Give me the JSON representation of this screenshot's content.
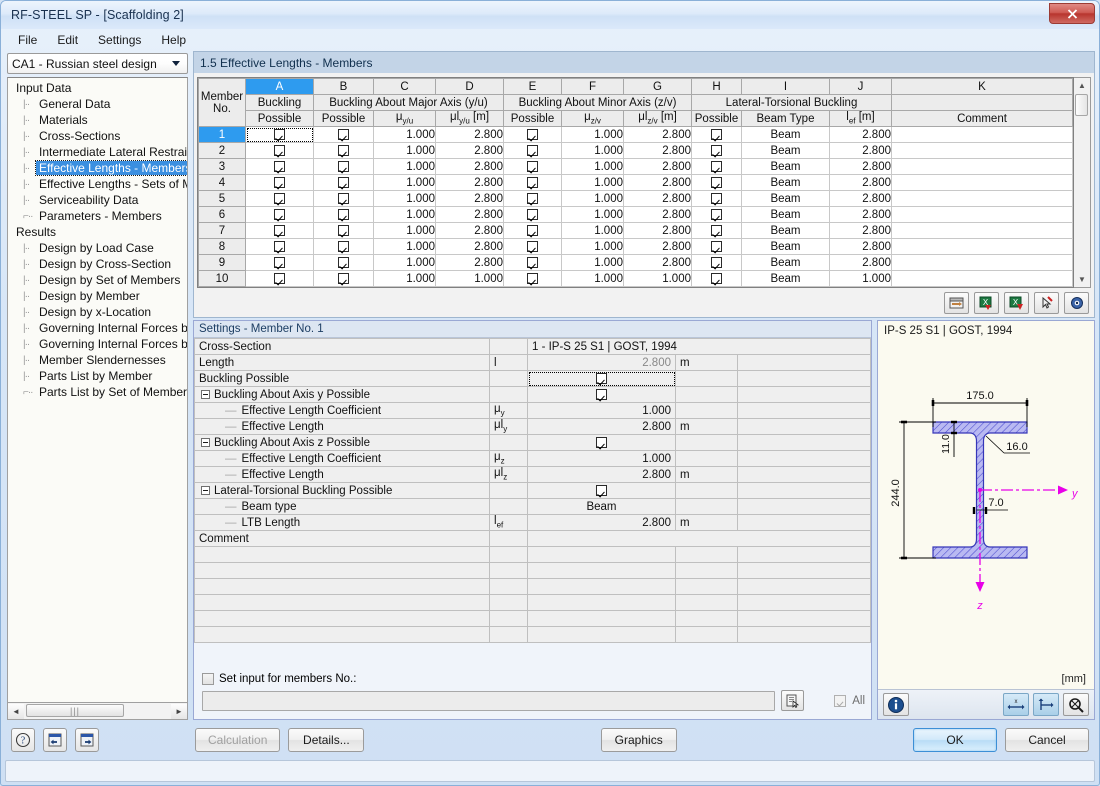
{
  "window": {
    "title": "RF-STEEL SP - [Scaffolding 2]",
    "close_label": "✕"
  },
  "menubar": {
    "items": [
      "File",
      "Edit",
      "Settings",
      "Help"
    ]
  },
  "sidebar": {
    "combo_value": "CA1 - Russian steel design",
    "groups": [
      {
        "label": "Input Data",
        "items": [
          "General Data",
          "Materials",
          "Cross-Sections",
          "Intermediate Lateral Restraints",
          "Effective Lengths - Members",
          "Effective Lengths - Sets of Mem",
          "Serviceability Data",
          "Parameters - Members"
        ],
        "selected": "Effective Lengths - Members"
      },
      {
        "label": "Results",
        "items": [
          "Design by Load Case",
          "Design by Cross-Section",
          "Design by Set of Members",
          "Design by Member",
          "Design by x-Location",
          "Governing Internal Forces by M",
          "Governing Internal Forces by Se",
          "Member Slendernesses",
          "Parts List by Member",
          "Parts List by Set of Members"
        ],
        "selected": ""
      }
    ]
  },
  "main": {
    "section_title": "1.5 Effective Lengths - Members",
    "table": {
      "column_letters": [
        "A",
        "B",
        "C",
        "D",
        "E",
        "F",
        "G",
        "H",
        "I",
        "J",
        "K"
      ],
      "selected_column": "A",
      "group_headers": [
        {
          "label": "",
          "span": 1
        },
        {
          "label": "",
          "span": 1
        },
        {
          "label": "Buckling About Major Axis (y/u)",
          "span": 3
        },
        {
          "label": "Buckling About Minor Axis (z/v)",
          "span": 3
        },
        {
          "label": "Lateral-Torsional Buckling",
          "span": 3
        },
        {
          "label": "",
          "span": 1
        }
      ],
      "row_header_line1": "Member",
      "row_header_line2": "No.",
      "sub_headers": [
        "Buckling",
        "Possible",
        "Possible",
        "μ|y/u|",
        "μl|y/u| [m]",
        "Possible",
        "μ|z/v|",
        "μl|z/v| [m]",
        "Possible",
        "Beam Type",
        "l|ef| [m]",
        "Comment"
      ],
      "sub_header_a_line1": "Buckling",
      "sub_header_a_line2": "Possible",
      "rows": [
        {
          "no": "1",
          "a": true,
          "b": true,
          "mu_y": "1.000",
          "mul_y": "2.800",
          "e": true,
          "mu_z": "1.000",
          "mul_z": "2.800",
          "h": true,
          "beam_type": "Beam",
          "lef": "2.800",
          "comment": ""
        },
        {
          "no": "2",
          "a": true,
          "b": true,
          "mu_y": "1.000",
          "mul_y": "2.800",
          "e": true,
          "mu_z": "1.000",
          "mul_z": "2.800",
          "h": true,
          "beam_type": "Beam",
          "lef": "2.800",
          "comment": ""
        },
        {
          "no": "3",
          "a": true,
          "b": true,
          "mu_y": "1.000",
          "mul_y": "2.800",
          "e": true,
          "mu_z": "1.000",
          "mul_z": "2.800",
          "h": true,
          "beam_type": "Beam",
          "lef": "2.800",
          "comment": ""
        },
        {
          "no": "4",
          "a": true,
          "b": true,
          "mu_y": "1.000",
          "mul_y": "2.800",
          "e": true,
          "mu_z": "1.000",
          "mul_z": "2.800",
          "h": true,
          "beam_type": "Beam",
          "lef": "2.800",
          "comment": ""
        },
        {
          "no": "5",
          "a": true,
          "b": true,
          "mu_y": "1.000",
          "mul_y": "2.800",
          "e": true,
          "mu_z": "1.000",
          "mul_z": "2.800",
          "h": true,
          "beam_type": "Beam",
          "lef": "2.800",
          "comment": ""
        },
        {
          "no": "6",
          "a": true,
          "b": true,
          "mu_y": "1.000",
          "mul_y": "2.800",
          "e": true,
          "mu_z": "1.000",
          "mul_z": "2.800",
          "h": true,
          "beam_type": "Beam",
          "lef": "2.800",
          "comment": ""
        },
        {
          "no": "7",
          "a": true,
          "b": true,
          "mu_y": "1.000",
          "mul_y": "2.800",
          "e": true,
          "mu_z": "1.000",
          "mul_z": "2.800",
          "h": true,
          "beam_type": "Beam",
          "lef": "2.800",
          "comment": ""
        },
        {
          "no": "8",
          "a": true,
          "b": true,
          "mu_y": "1.000",
          "mul_y": "2.800",
          "e": true,
          "mu_z": "1.000",
          "mul_z": "2.800",
          "h": true,
          "beam_type": "Beam",
          "lef": "2.800",
          "comment": ""
        },
        {
          "no": "9",
          "a": true,
          "b": true,
          "mu_y": "1.000",
          "mul_y": "2.800",
          "e": true,
          "mu_z": "1.000",
          "mul_z": "2.800",
          "h": true,
          "beam_type": "Beam",
          "lef": "2.800",
          "comment": ""
        },
        {
          "no": "10",
          "a": true,
          "b": true,
          "mu_y": "1.000",
          "mul_y": "1.000",
          "e": true,
          "mu_z": "1.000",
          "mul_z": "1.000",
          "h": true,
          "beam_type": "Beam",
          "lef": "1.000",
          "comment": ""
        }
      ],
      "selected_row": "1"
    },
    "table_toolbar": [
      "import-table-icon",
      "excel-import-icon",
      "excel-export-icon",
      "pick-member-icon",
      "view-icon"
    ]
  },
  "settings": {
    "title": "Settings - Member No. 1",
    "rows": [
      {
        "kind": "plain",
        "label": "Cross-Section",
        "symbol": "",
        "value": "1 - IP-S 25 S1 | GOST, 1994",
        "unit": "",
        "value_style": "crosssection"
      },
      {
        "kind": "plain",
        "label": "Length",
        "symbol": "l",
        "value": "2.800",
        "unit": "m",
        "value_style": "gray"
      },
      {
        "kind": "plain",
        "label": "Buckling Possible",
        "symbol": "",
        "value": "checked",
        "unit": "",
        "value_style": "check-focus"
      },
      {
        "kind": "group",
        "label": "Buckling About Axis y Possible",
        "symbol": "",
        "value": "checked",
        "unit": "",
        "value_style": "check"
      },
      {
        "kind": "child",
        "label": "Effective Length Coefficient",
        "symbol": "μy",
        "value": "1.000",
        "unit": "",
        "value_style": "num"
      },
      {
        "kind": "child",
        "label": "Effective Length",
        "symbol": "μly",
        "value": "2.800",
        "unit": "m",
        "value_style": "num"
      },
      {
        "kind": "group",
        "label": "Buckling About Axis z Possible",
        "symbol": "",
        "value": "checked",
        "unit": "",
        "value_style": "check"
      },
      {
        "kind": "child",
        "label": "Effective Length Coefficient",
        "symbol": "μz",
        "value": "1.000",
        "unit": "",
        "value_style": "num"
      },
      {
        "kind": "child",
        "label": "Effective Length",
        "symbol": "μlz",
        "value": "2.800",
        "unit": "m",
        "value_style": "num"
      },
      {
        "kind": "group",
        "label": "Lateral-Torsional Buckling Possible",
        "symbol": "",
        "value": "checked",
        "unit": "",
        "value_style": "check"
      },
      {
        "kind": "child",
        "label": "Beam type",
        "symbol": "",
        "value": "Beam",
        "unit": "",
        "value_style": "ctr"
      },
      {
        "kind": "child",
        "label": "LTB Length",
        "symbol": "lef",
        "value": "2.800",
        "unit": "m",
        "value_style": "num"
      },
      {
        "kind": "plain",
        "label": "Comment",
        "symbol": "",
        "value": "",
        "unit": "",
        "value_style": "text"
      }
    ],
    "empty_row_count": 6,
    "set_input_label": "Set input for members No.:",
    "set_input_checked": false,
    "member_input_value": "",
    "all_label": "All",
    "all_checked": true
  },
  "cross_section": {
    "title": "IP-S 25 S1 | GOST, 1994",
    "unit_label": "[mm]",
    "dimensions": {
      "width": "175.0",
      "height": "244.0",
      "flange_thickness": "11.0",
      "web_thickness": "7.0",
      "root_radius": "16.0"
    },
    "axis_labels": {
      "horizontal": "y",
      "vertical": "z"
    },
    "colors": {
      "section_fill": "#8a8ae8",
      "axis": "#e800e8",
      "background": "#fbfaf0"
    },
    "toolbar": [
      "info-icon",
      "dimensions-icon",
      "axes-icon",
      "zoom-icon"
    ]
  },
  "footer": {
    "help_icon": "help-icon",
    "prev_icon": "previous-icon",
    "next_icon": "next-icon",
    "calculation_label": "Calculation",
    "calculation_disabled": true,
    "details_label": "Details...",
    "graphics_label": "Graphics",
    "ok_label": "OK",
    "cancel_label": "Cancel"
  }
}
